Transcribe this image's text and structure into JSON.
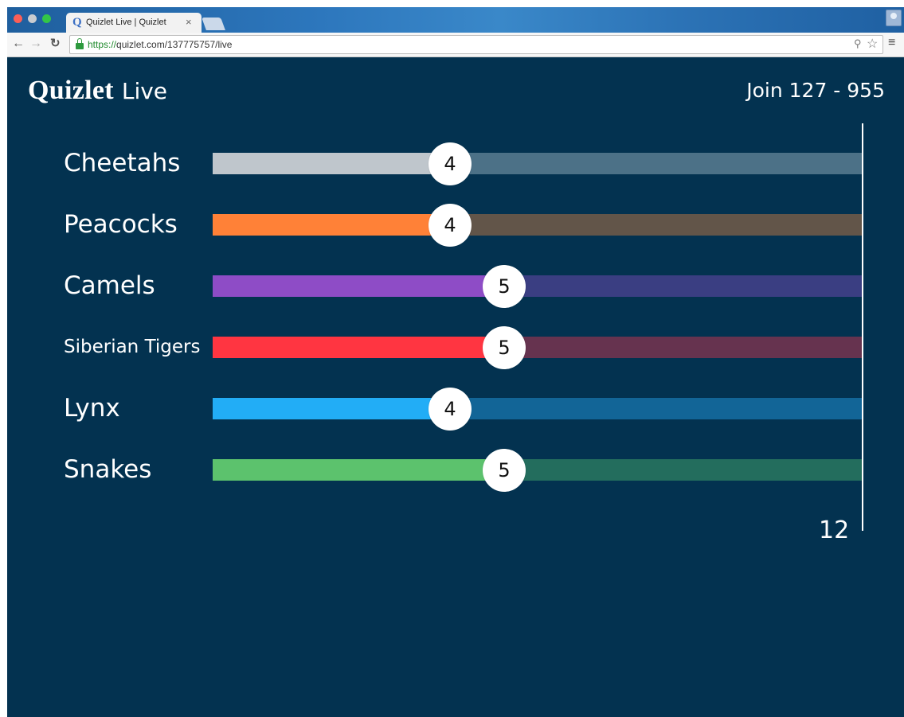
{
  "browser": {
    "tab_title": "Quizlet Live | Quizlet",
    "tab_favicon": "Q",
    "tab_close": "×",
    "url_scheme": "https://",
    "url_rest": "quizlet.com/137775757/live",
    "icons": [
      "back-arrow-icon",
      "forward-arrow-icon",
      "reload-icon",
      "lock-icon",
      "zoom-icon",
      "star-icon",
      "menu-icon",
      "profile-icon"
    ]
  },
  "header": {
    "logo_brand": "Quizlet",
    "logo_product": "Live",
    "join_text": "Join 127 - 955"
  },
  "race": {
    "goal": 12,
    "goal_label": "12",
    "teams": [
      {
        "name": "Cheetahs",
        "score": 4,
        "color": "#bfc6cc",
        "track": "#4c7187"
      },
      {
        "name": "Peacocks",
        "score": 4,
        "color": "#ff8137",
        "track": "#625549"
      },
      {
        "name": "Camels",
        "score": 5,
        "color": "#8e4cc6",
        "track": "#3a3e82"
      },
      {
        "name": "Siberian Tigers",
        "score": 5,
        "color": "#ff3541",
        "track": "#66334f"
      },
      {
        "name": "Lynx",
        "score": 4,
        "color": "#22adf6",
        "track": "#126597"
      },
      {
        "name": "Snakes",
        "score": 5,
        "color": "#5cc26d",
        "track": "#236d5d"
      }
    ]
  }
}
